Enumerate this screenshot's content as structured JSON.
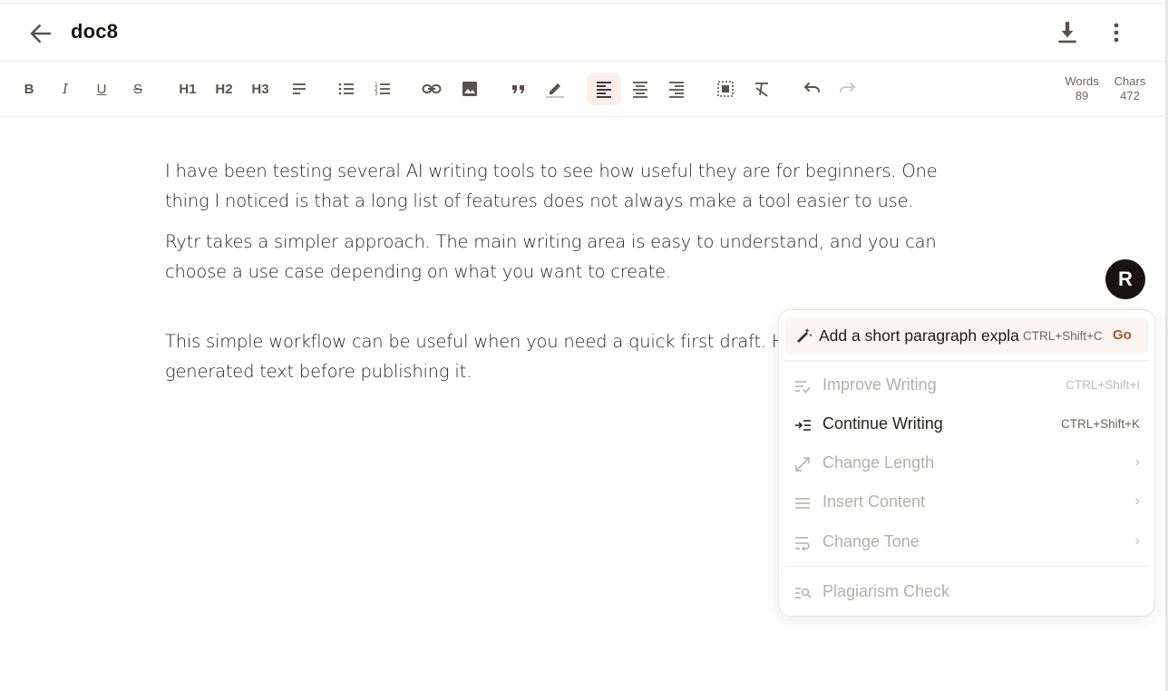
{
  "header": {
    "back_icon": "arrow-left-icon",
    "title": "doc8",
    "download_icon": "download-icon",
    "more_icon": "more-vertical-icon"
  },
  "toolbar": {
    "bold": "B",
    "italic": "I",
    "underline": "U",
    "strike": "S",
    "h1": "H1",
    "h2": "H2",
    "h3": "H3",
    "words_label": "Words",
    "words_value": "89",
    "chars_label": "Chars",
    "chars_value": "472",
    "active_color": "#fcefe9"
  },
  "editor": {
    "paragraphs": [
      "I have been testing several AI writing tools to see how useful they are for beginners. One thing I noticed is that a long list of features does not always make a tool easier to use.",
      "Rytr takes a simpler approach. The main writing area is easy to understand, and you can choose a use case depending on what you want to create.",
      "This simple workflow can be useful when you need a quick first draft. However, edit the generated text before publishing it."
    ]
  },
  "rytr": {
    "avatar_letter": "R"
  },
  "popup": {
    "prompt_text": "Add a short paragraph explaining",
    "prompt_shortcut": "CTRL+Shift+C",
    "prompt_go": "Go",
    "accent_color": "#b5531c",
    "items": [
      {
        "label": "Improve Writing",
        "shortcut": "CTRL+Shift+I",
        "icon": "improve-writing-icon",
        "enabled": false
      },
      {
        "label": "Continue Writing",
        "shortcut": "CTRL+Shift+K",
        "icon": "continue-writing-icon",
        "enabled": true
      },
      {
        "label": "Change Length",
        "chevron": "›",
        "icon": "resize-icon",
        "enabled": false
      },
      {
        "label": "Insert Content",
        "chevron": "›",
        "icon": "insert-content-icon",
        "enabled": false
      },
      {
        "label": "Change Tone",
        "chevron": "›",
        "icon": "change-tone-icon",
        "enabled": false
      },
      {
        "label": "Plagiarism Check",
        "icon": "plagiarism-check-icon",
        "enabled": false
      }
    ]
  }
}
